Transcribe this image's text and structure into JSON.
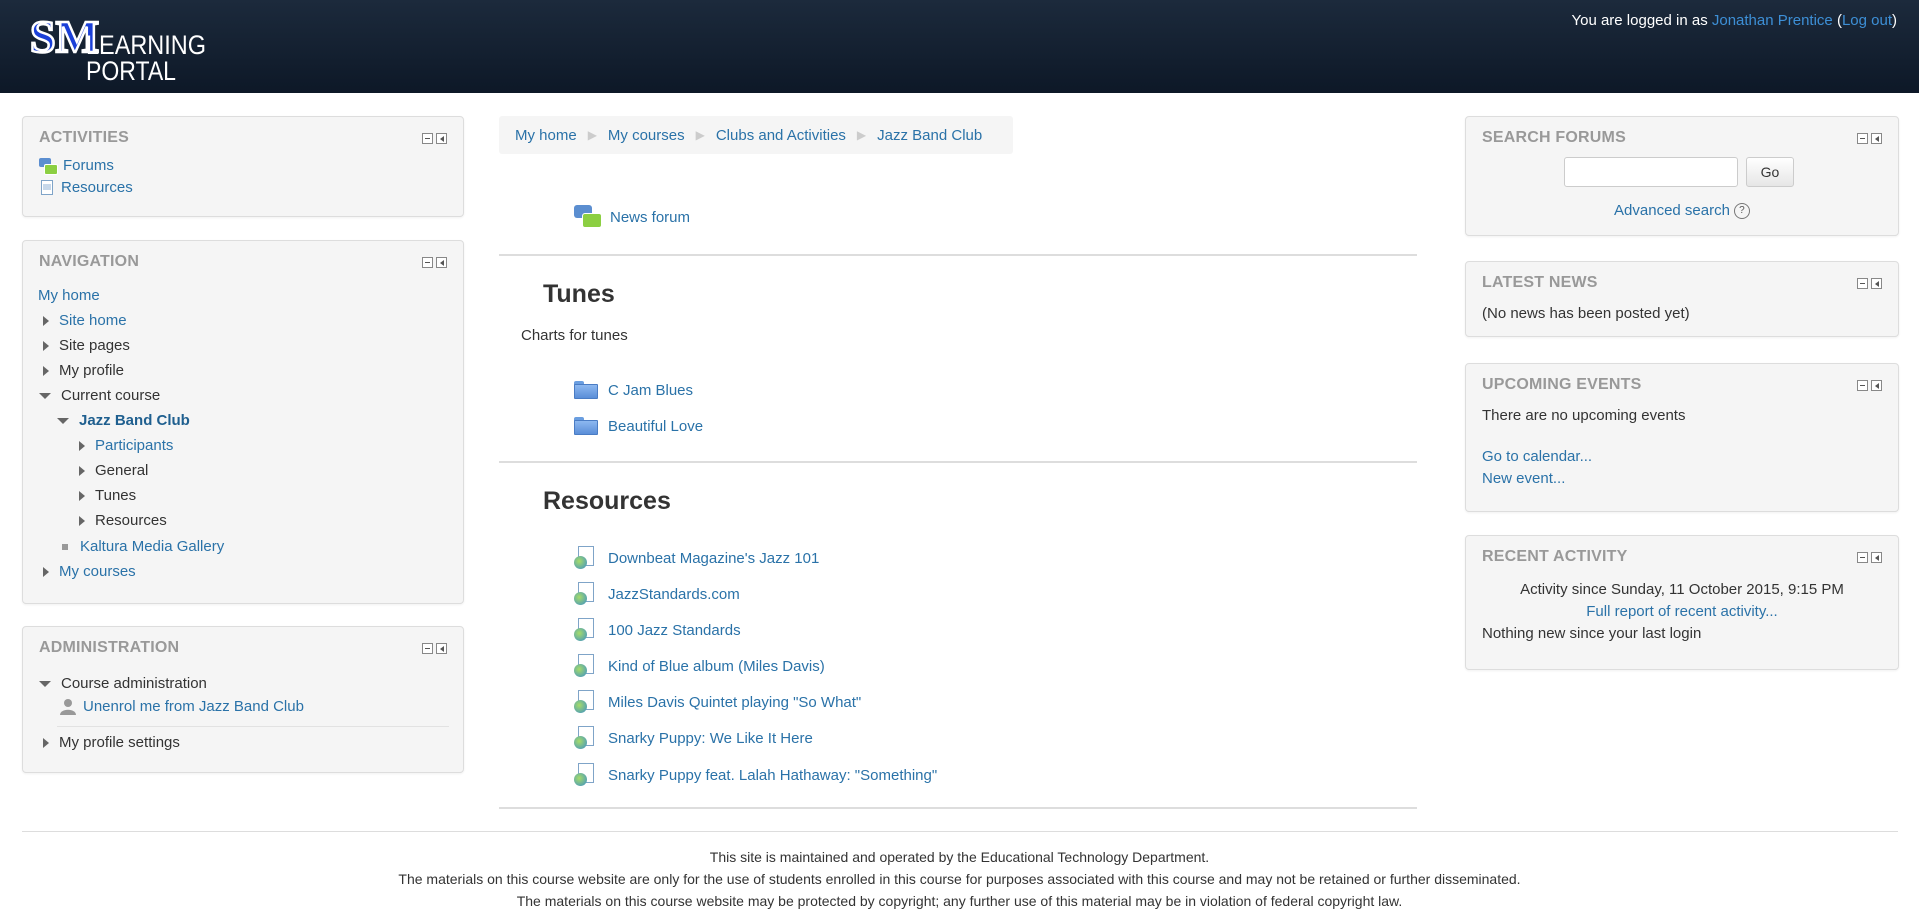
{
  "header": {
    "logo": {
      "monogram": "SM",
      "line1": "LEARNING",
      "line2": "PORTAL"
    },
    "login_prefix": "You are logged in as ",
    "user_name": "Jonathan Prentice",
    "open_paren": " (",
    "logout": "Log out",
    "close_paren": ")"
  },
  "activities": {
    "title": "ACTIVITIES",
    "items": [
      {
        "label": "Forums",
        "icon": "forum-icon"
      },
      {
        "label": "Resources",
        "icon": "resource-icon"
      }
    ]
  },
  "navigation": {
    "title": "NAVIGATION",
    "my_home": "My home",
    "site_home": "Site home",
    "site_pages": "Site pages",
    "my_profile": "My profile",
    "current_course": "Current course",
    "course_name": "Jazz Band Club",
    "participants": "Participants",
    "general": "General",
    "tunes": "Tunes",
    "resources": "Resources",
    "kaltura": "Kaltura Media Gallery",
    "my_courses": "My courses"
  },
  "administration": {
    "title": "ADMINISTRATION",
    "course_admin": "Course administration",
    "unenrol": "Unenrol me from Jazz Band Club",
    "profile_settings": "My profile settings"
  },
  "breadcrumb": [
    "My home",
    "My courses",
    "Clubs and Activities",
    "Jazz Band Club"
  ],
  "main": {
    "news_forum": "News forum",
    "tunes": {
      "title": "Tunes",
      "summary": "Charts for tunes",
      "folders": [
        "C Jam Blues",
        "Beautiful Love"
      ]
    },
    "resources": {
      "title": "Resources",
      "links": [
        "Downbeat Magazine's Jazz 101",
        "JazzStandards.com",
        "100 Jazz Standards",
        "Kind of Blue album (Miles Davis)",
        "Miles Davis Quintet playing \"So What\"",
        "Snarky Puppy: We Like It Here",
        "Snarky Puppy feat. Lalah Hathaway: \"Something\""
      ]
    }
  },
  "search_forums": {
    "title": "SEARCH FORUMS",
    "go": "Go",
    "advanced": "Advanced search",
    "help": "?"
  },
  "latest_news": {
    "title": "LATEST NEWS",
    "text": "(No news has been posted yet)"
  },
  "upcoming_events": {
    "title": "UPCOMING EVENTS",
    "text": "There are no upcoming events",
    "calendar": "Go to calendar...",
    "new_event": "New event..."
  },
  "recent_activity": {
    "title": "RECENT ACTIVITY",
    "since": "Activity since Sunday, 11 October 2015, 9:15 PM",
    "full_report": "Full report of recent activity...",
    "nothing": "Nothing new since your last login"
  },
  "footer": {
    "line1": "This site is maintained and operated by the Educational Technology Department.",
    "line2": "The materials on this course website are only for the use of students enrolled in this course for purposes associated with this course and may not be retained or further disseminated.",
    "line3": "The materials on this course website may be protected by copyright; any further use of this material may be in violation of federal copyright law."
  }
}
